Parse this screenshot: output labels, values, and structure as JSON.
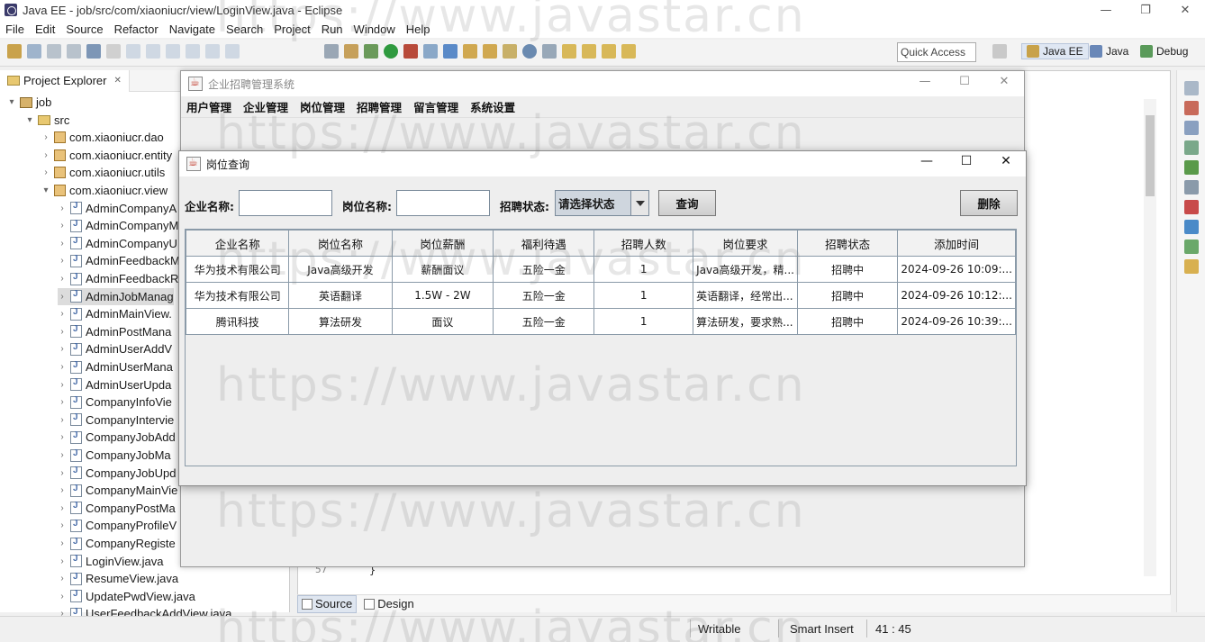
{
  "eclipse": {
    "window_title": "Java EE - job/src/com/xiaoniucr/view/LoginView.java - Eclipse",
    "menu": [
      "File",
      "Edit",
      "Source",
      "Refactor",
      "Navigate",
      "Search",
      "Project",
      "Run",
      "Window",
      "Help"
    ],
    "quick_access": "Quick Access",
    "perspectives": [
      "Java EE",
      "Java",
      "Debug"
    ],
    "explorer": {
      "tab_label": "Project Explorer",
      "tab_close": "✕",
      "project": "job",
      "src": "src",
      "packages": [
        "com.xiaoniucr.dao",
        "com.xiaoniucr.entity",
        "com.xiaoniucr.utils",
        "com.xiaoniucr.view"
      ],
      "files": [
        "AdminCompanyA",
        "AdminCompanyM",
        "AdminCompanyU",
        "AdminFeedbackM",
        "AdminFeedbackR",
        "AdminJobManag",
        "AdminMainView.",
        "AdminPostMana",
        "AdminUserAddV",
        "AdminUserMana",
        "AdminUserUpda",
        "CompanyInfoVie",
        "CompanyIntervie",
        "CompanyJobAdd",
        "CompanyJobMa",
        "CompanyJobUpd",
        "CompanyMainVie",
        "CompanyPostMa",
        "CompanyProfileV",
        "CompanyRegiste",
        "LoginView.java",
        "ResumeView.java",
        "UpdatePwdView.java",
        "UserFeedbackAddView.java"
      ]
    },
    "editor": {
      "line_number": "57",
      "code": "}",
      "tabs": [
        "Source",
        "Design"
      ]
    },
    "status": {
      "writable": "Writable",
      "insert_mode": "Smart Insert",
      "position": "41 : 45"
    }
  },
  "main_frame": {
    "title": "企业招聘管理系统",
    "menu": [
      "用户管理",
      "企业管理",
      "岗位管理",
      "招聘管理",
      "留言管理",
      "系统设置"
    ]
  },
  "dialog": {
    "title": "岗位查询",
    "company_label": "企业名称:",
    "company_value": "",
    "job_label": "岗位名称:",
    "job_value": "",
    "status_label": "招聘状态:",
    "status_value": "请选择状态",
    "query_button": "查询",
    "delete_button": "删除",
    "columns": [
      "企业名称",
      "岗位名称",
      "岗位薪酬",
      "福利待遇",
      "招聘人数",
      "岗位要求",
      "招聘状态",
      "添加时间"
    ],
    "rows": [
      [
        "华为技术有限公司",
        "Java高级开发",
        "薪酬面议",
        "五险一金",
        "1",
        "Java高级开发，精...",
        "招聘中",
        "2024-09-26 10:09:..."
      ],
      [
        "华为技术有限公司",
        "英语翻译",
        "1.5W - 2W",
        "五险一金",
        "1",
        "英语翻译，经常出...",
        "招聘中",
        "2024-09-26 10:12:..."
      ],
      [
        "腾讯科技",
        "算法研发",
        "面议",
        "五险一金",
        "1",
        "算法研发，要求熟...",
        "招聘中",
        "2024-09-26 10:39:..."
      ]
    ]
  },
  "watermark": "https://www.javastar.cn",
  "colors": {
    "select_bg": "#cfd6de",
    "table_border": "#8a9aa8"
  }
}
